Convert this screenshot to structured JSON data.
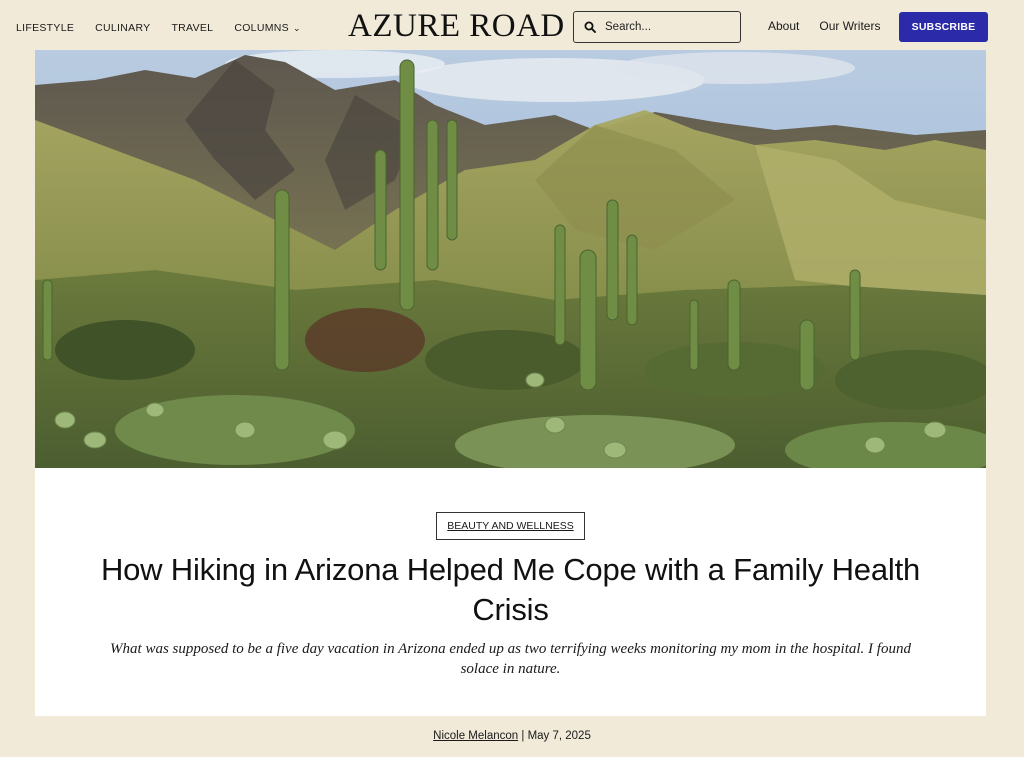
{
  "header": {
    "nav_left": [
      {
        "label": "LIFESTYLE"
      },
      {
        "label": "CULINARY"
      },
      {
        "label": "TRAVEL"
      },
      {
        "label": "COLUMNS",
        "has_dropdown": true
      }
    ],
    "logo": "AZURE ROAD",
    "search": {
      "placeholder": "Search...",
      "icon": "search-icon"
    },
    "nav_right": [
      {
        "label": "About"
      },
      {
        "label": "Our Writers"
      }
    ],
    "subscribe_label": "SUBSCRIBE"
  },
  "colors": {
    "background": "#f1ead9",
    "card": "#ffffff",
    "subscribe": "#2b2aa8"
  },
  "article": {
    "category": "BEAUTY AND WELLNESS",
    "title": "How Hiking in Arizona Helped Me Cope with a Family Health Crisis",
    "dek": "What was supposed to be a five day vacation in Arizona ended up as two terrifying weeks monitoring my mom in the hospital. I found solace in nature.",
    "author": "Nicole Melancon",
    "separator": "|",
    "date": "May 7, 2025"
  }
}
